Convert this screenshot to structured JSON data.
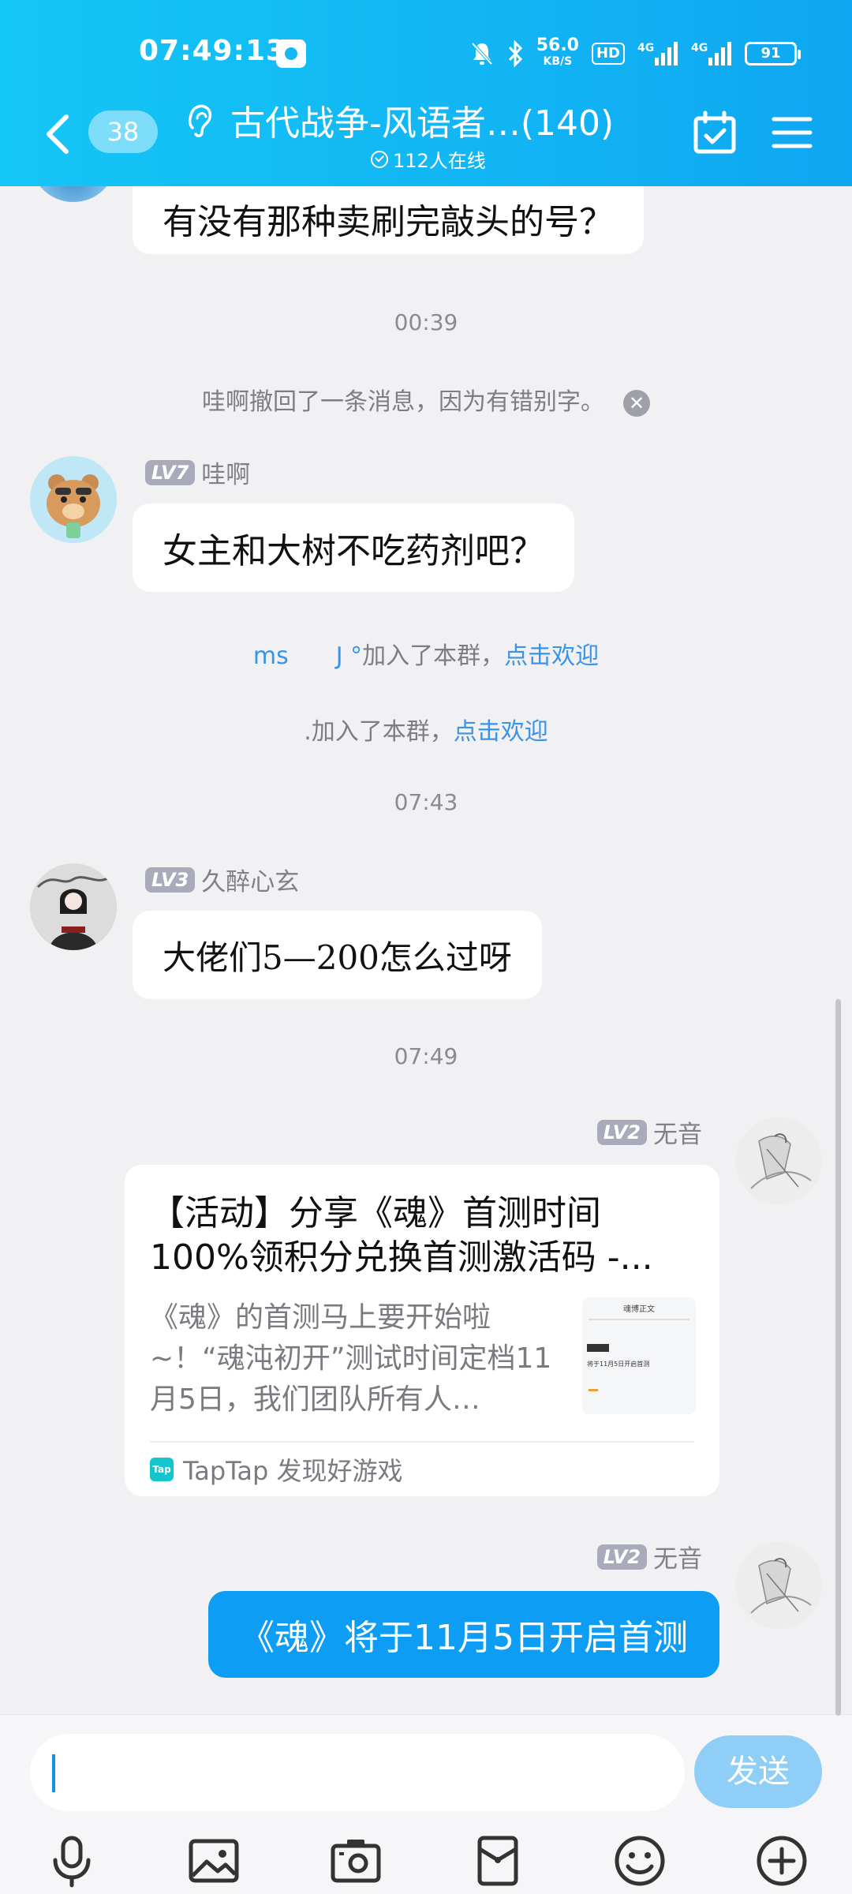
{
  "status": {
    "time": "07:49:13",
    "net_speed": "56.0",
    "net_unit": "KB/S",
    "hd": "HD",
    "net1": "4G",
    "net2": "4G",
    "battery": "91"
  },
  "header": {
    "unread_count": "38",
    "title": "古代战争-风语者…(140)",
    "online": "112人在线"
  },
  "messages": {
    "m1_text": "有没有那种卖刷完敲头的号？",
    "ts1": "00:39",
    "recall_text": "哇啊撤回了一条消息，因为有错别字。",
    "m2_level": "LV7",
    "m2_name": "哇啊",
    "m2_text": "女主和大树不吃药剂吧？",
    "join1_name": "ms　　J °",
    "join1_text": "加入了本群，",
    "join1_link": "点击欢迎",
    "join2_name": ".",
    "join2_text": "加入了本群，",
    "join2_link": "点击欢迎",
    "ts2": "07:43",
    "m3_level": "LV3",
    "m3_name": "久醉心玄",
    "m3_text": "大佬们5—200怎么过呀",
    "ts3": "07:49",
    "m4_level": "LV2",
    "m4_name": "无音",
    "card_title": "【活动】分享《魂》首测时间100%领积分兑换首测激活码 -...",
    "card_desc": "《魂》的首测马上要开始啦~！“魂沌初开”测试时间定档11月5日，我们团队所有人…",
    "card_source": "TapTap 发现好游戏",
    "card_source_logo": "Tap",
    "card_thumb_title": "魂博正文",
    "card_thumb_line": "将于11月5日开启首测",
    "m5_level": "LV2",
    "m5_name": "无音",
    "m5_text": "《魂》将于11月5日开启首测"
  },
  "input": {
    "send_label": "发送"
  },
  "toolbar": {
    "icons": [
      "microphone-icon",
      "image-icon",
      "camera-icon",
      "red-packet-icon",
      "emoji-icon",
      "plus-icon"
    ]
  },
  "colors": {
    "header_gradient_start": "#14c6f6",
    "header_gradient_end": "#0ea7f1",
    "own_bubble": "#0d9df4",
    "link": "#3a93e6",
    "send_button": "#8fcff7"
  }
}
